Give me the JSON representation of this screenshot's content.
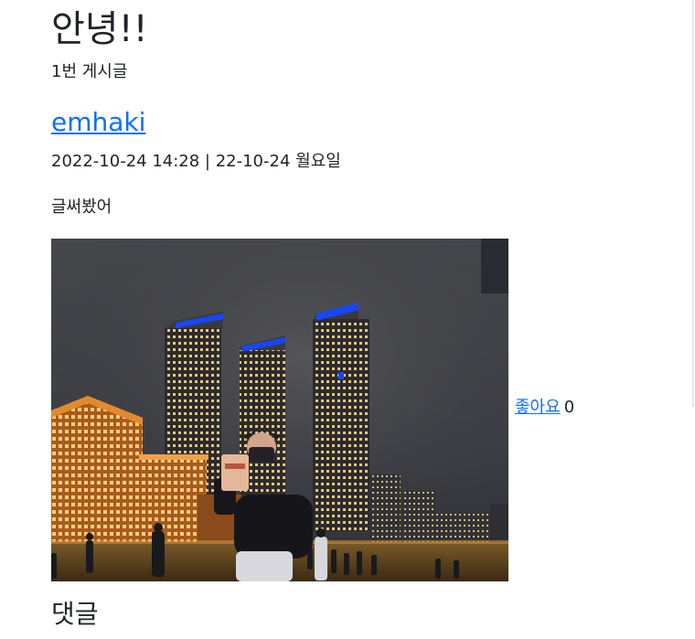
{
  "post": {
    "title": "안녕!!",
    "post_number_label": "1번 게시글",
    "author": "emhaki",
    "meta": "2022-10-24 14:28 | 22-10-24 월요일",
    "body": "글써봤어",
    "like_label": "좋아요",
    "like_count": "0"
  },
  "comments": {
    "heading": "댓글"
  },
  "colors": {
    "link": "#0d6efd",
    "text": "#212529",
    "tower_light": "#1846ff"
  }
}
